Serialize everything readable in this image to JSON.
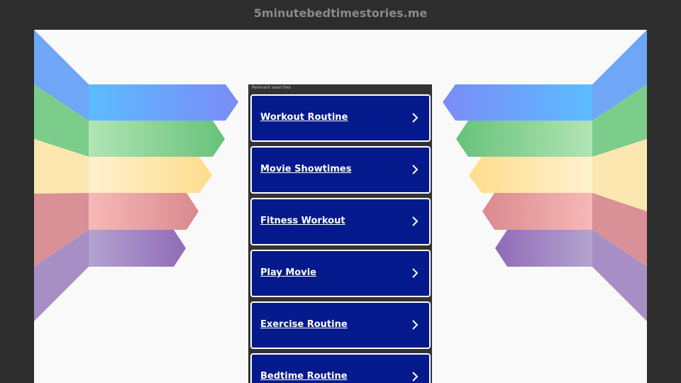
{
  "header": {
    "domain": "5minutebedtimestories.me"
  },
  "sidebar": {
    "heading": "Relevant searches"
  },
  "links": [
    {
      "label": "Workout Routine"
    },
    {
      "label": "Movie Showtimes"
    },
    {
      "label": "Fitness Workout"
    },
    {
      "label": "Play Movie"
    },
    {
      "label": "Exercise Routine"
    },
    {
      "label": "Bedtime Routine"
    }
  ],
  "icons": {
    "link_arrow": "chevron-right-icon"
  },
  "colors": {
    "page_background": "#2d2d2d",
    "content_background": "#f9f9fa",
    "link_card": "#051a8c",
    "stripe_blue": "#5fb8ff",
    "stripe_green": "#7dcf8a",
    "stripe_yellow": "#ffe3a0",
    "stripe_red": "#f0a6a6",
    "stripe_purple": "#9b7ec2"
  }
}
